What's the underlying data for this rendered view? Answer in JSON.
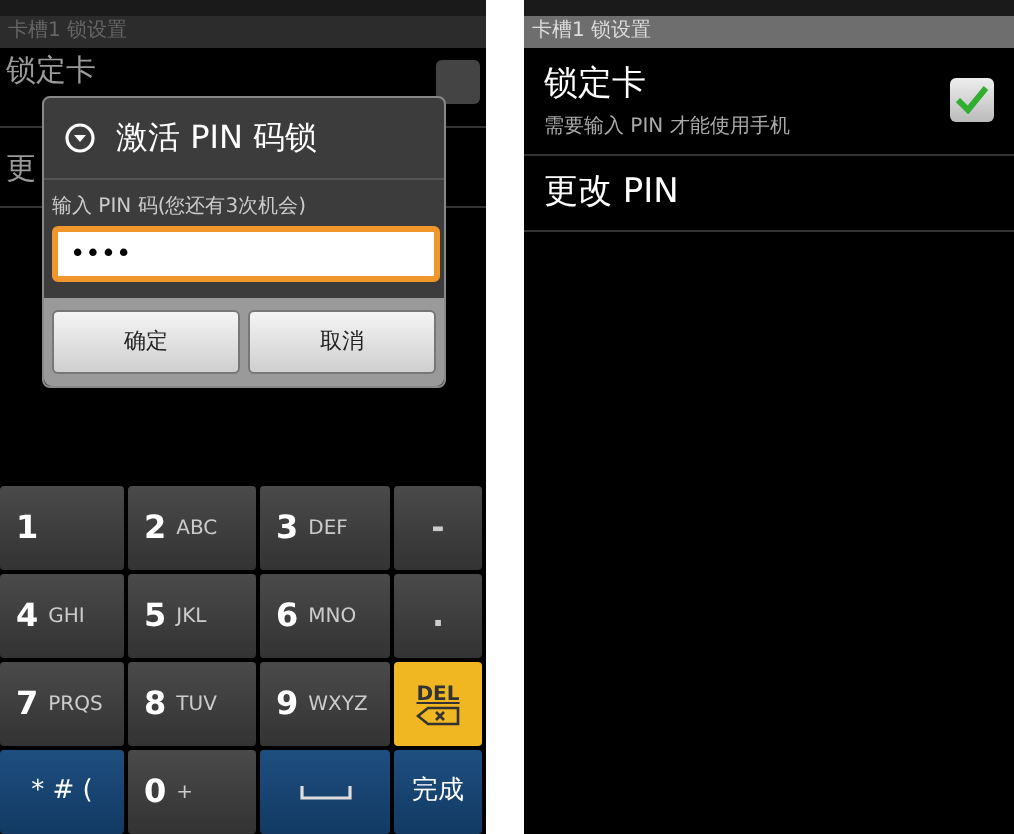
{
  "left_screen": {
    "title_bar": "卡槽1 锁设置",
    "background_items": [
      {
        "title": "锁定卡",
        "checked": false
      },
      {
        "title": "更"
      }
    ],
    "dialog": {
      "title": "激活 PIN 码锁",
      "label": "输入 PIN 码(您还有3次机会)",
      "value": "••••",
      "buttons": [
        "确定",
        "取消"
      ]
    },
    "keypad": [
      {
        "kind": "digit",
        "label": "1"
      },
      {
        "kind": "digit",
        "label": "2",
        "sub": "ABC"
      },
      {
        "kind": "digit",
        "label": "3",
        "sub": "DEF"
      },
      {
        "kind": "symbol",
        "label": "-"
      },
      {
        "kind": "digit",
        "label": "4",
        "sub": "GHI"
      },
      {
        "kind": "digit",
        "label": "5",
        "sub": "JKL"
      },
      {
        "kind": "digit",
        "label": "6",
        "sub": "MNO"
      },
      {
        "kind": "symbol",
        "label": "."
      },
      {
        "kind": "digit",
        "label": "7",
        "sub": "PRQS"
      },
      {
        "kind": "digit",
        "label": "8",
        "sub": "TUV"
      },
      {
        "kind": "digit",
        "label": "9",
        "sub": "WXYZ"
      },
      {
        "kind": "delete",
        "label": "DEL"
      },
      {
        "kind": "mode",
        "label": "* # ("
      },
      {
        "kind": "digit",
        "label": "0",
        "sub": "+"
      },
      {
        "kind": "space"
      },
      {
        "kind": "done",
        "label": "完成"
      }
    ]
  },
  "right_screen": {
    "title_bar": "卡槽1 锁设置",
    "items": [
      {
        "title": "锁定卡",
        "subtitle": "需要输入 PIN 才能使用手机",
        "checked": true
      },
      {
        "title": "更改 PIN"
      }
    ]
  }
}
